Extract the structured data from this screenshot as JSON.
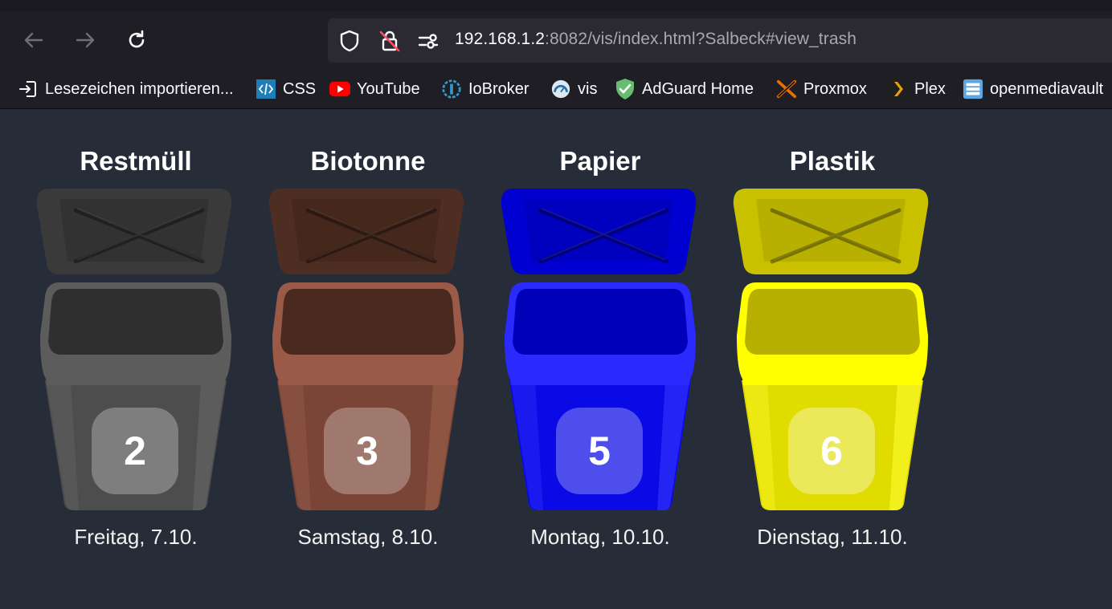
{
  "browser": {
    "url_host": "192.168.1.2",
    "url_rest": ":8082/vis/index.html?Salbeck#view_trash",
    "bookmarks": [
      {
        "label": "Lesezeichen importieren...",
        "icon": "import-icon"
      },
      {
        "label": "CSS",
        "icon": "code-icon"
      },
      {
        "label": "YouTube",
        "icon": "youtube-icon"
      },
      {
        "label": "IoBroker",
        "icon": "iobroker-icon"
      },
      {
        "label": "vis",
        "icon": "vis-icon"
      },
      {
        "label": "AdGuard Home",
        "icon": "shield-check-icon"
      },
      {
        "label": "Proxmox",
        "icon": "proxmox-icon"
      },
      {
        "label": "Plex",
        "icon": "plex-icon"
      },
      {
        "label": "openmediavault",
        "icon": "server-icon"
      }
    ]
  },
  "bins": [
    {
      "title": "Restmüll",
      "count": "2",
      "date": "Freitag, 7.10.",
      "color": "#555555"
    },
    {
      "title": "Biotonne",
      "count": "3",
      "date": "Samstag, 8.10.",
      "color": "#8a4a3a"
    },
    {
      "title": "Papier",
      "count": "5",
      "date": "Montag, 10.10.",
      "color": "#1010ee"
    },
    {
      "title": "Plastik",
      "count": "6",
      "date": "Dienstag, 11.10.",
      "color": "#e6e600"
    }
  ]
}
